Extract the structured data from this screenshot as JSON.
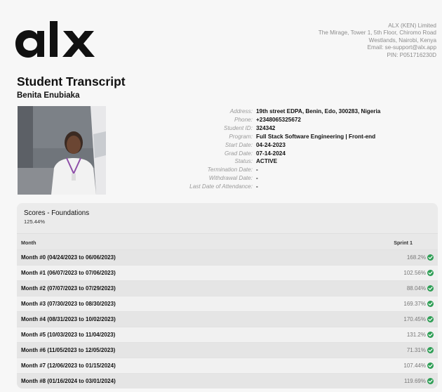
{
  "company": {
    "name": "ALX (KEN) Limited",
    "address_line1": "The Mirage, Tower 1, 5th Floor, Chiromo Road",
    "address_line2": "Westlands, Nairobi, Kenya",
    "email": "Email: se-support@alx.app",
    "pin": "PIN: P051716230D"
  },
  "logo": {
    "text": "alx",
    "color": "#111111"
  },
  "document": {
    "title": "Student Transcript",
    "student_name": "Benita Enubiaka"
  },
  "details": [
    {
      "label": "Address:",
      "value": "19th street EDPA, Benin, Edo, 300283, Nigeria"
    },
    {
      "label": "Phone:",
      "value": "+2348065325672"
    },
    {
      "label": "Student ID:",
      "value": "324342"
    },
    {
      "label": "Program:",
      "value": "Full Stack Software Engineering | Front-end"
    },
    {
      "label": "Start Date:",
      "value": "04-24-2023"
    },
    {
      "label": "Grad Date:",
      "value": "07-14-2024"
    },
    {
      "label": "Status:",
      "value": "ACTIVE"
    },
    {
      "label": "Termination Date:",
      "value": "-"
    },
    {
      "label": "Withdrawal Date:",
      "value": "-"
    },
    {
      "label": "Last Date of Attendance:",
      "value": "-"
    }
  ],
  "scores": {
    "title": "Scores - Foundations",
    "total": "125.44%",
    "col_month": "Month",
    "col_sprint": "Sprint 1",
    "check_color": "#2e9e55",
    "rows": [
      {
        "month": "Month #0 (04/24/2023 to 06/06/2023)",
        "score": "168.2%"
      },
      {
        "month": "Month #1 (06/07/2023 to 07/06/2023)",
        "score": "102.56%"
      },
      {
        "month": "Month #2 (07/07/2023 to 07/29/2023)",
        "score": "88.04%"
      },
      {
        "month": "Month #3 (07/30/2023 to 08/30/2023)",
        "score": "169.37%"
      },
      {
        "month": "Month #4 (08/31/2023 to 10/02/2023)",
        "score": "170.45%"
      },
      {
        "month": "Month #5 (10/03/2023 to 11/04/2023)",
        "score": "131.2%"
      },
      {
        "month": "Month #6 (11/05/2023 to 12/05/2023)",
        "score": "71.31%"
      },
      {
        "month": "Month #7 (12/06/2023 to 01/15/2024)",
        "score": "107.44%"
      },
      {
        "month": "Month #8 (01/16/2024 to 03/01/2024)",
        "score": "119.69%"
      }
    ]
  }
}
